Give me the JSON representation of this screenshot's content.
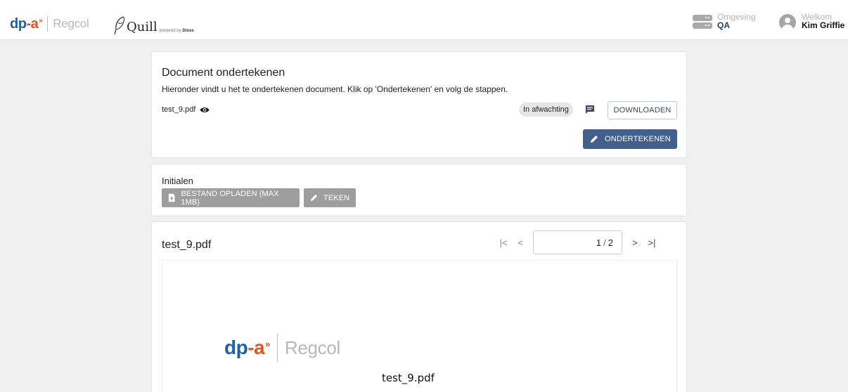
{
  "header": {
    "logo_dp": "dp",
    "logo_dash": "-a",
    "logo_arrows": "»",
    "logo_regcol": "Regcol",
    "quill_text": "Quill",
    "quill_powered": "powered by",
    "quill_brand": "Dioss",
    "env_label": "Omgeving",
    "env_value": "QA",
    "welcome_label": "Welkom",
    "user_name": "Kim Griffie"
  },
  "document": {
    "title": "Document ondertekenen",
    "description": "Hieronder vindt u het te ondertekenen document. Klik op 'Ondertekenen' en volg de stappen.",
    "file_name": "test_9.pdf",
    "status": "In afwachting",
    "download_label": "DOWNLOADEN",
    "sign_label": "ONDERTEKENEN"
  },
  "initials": {
    "label": "Initialen",
    "upload_label": "BESTAND OPLADEN (MAX 1MB)",
    "draw_label": "TEKEN"
  },
  "viewer": {
    "title": "test_9.pdf",
    "current_page": "1",
    "separator": "/",
    "total_pages": "2",
    "first_icon": "|<",
    "prev_icon": "<",
    "next_icon": ">",
    "last_icon": ">|",
    "pdf_logo_dp": "dp",
    "pdf_logo_dash": "-a",
    "pdf_logo_arrows": "»",
    "pdf_logo_regcol": "Regcol",
    "pdf_file_name": "test_9.pdf"
  },
  "colors": {
    "brand_blue": "#1b63a9",
    "brand_orange": "#e3541e",
    "primary_button": "#425f8e",
    "env_value": "#1f3f73"
  }
}
